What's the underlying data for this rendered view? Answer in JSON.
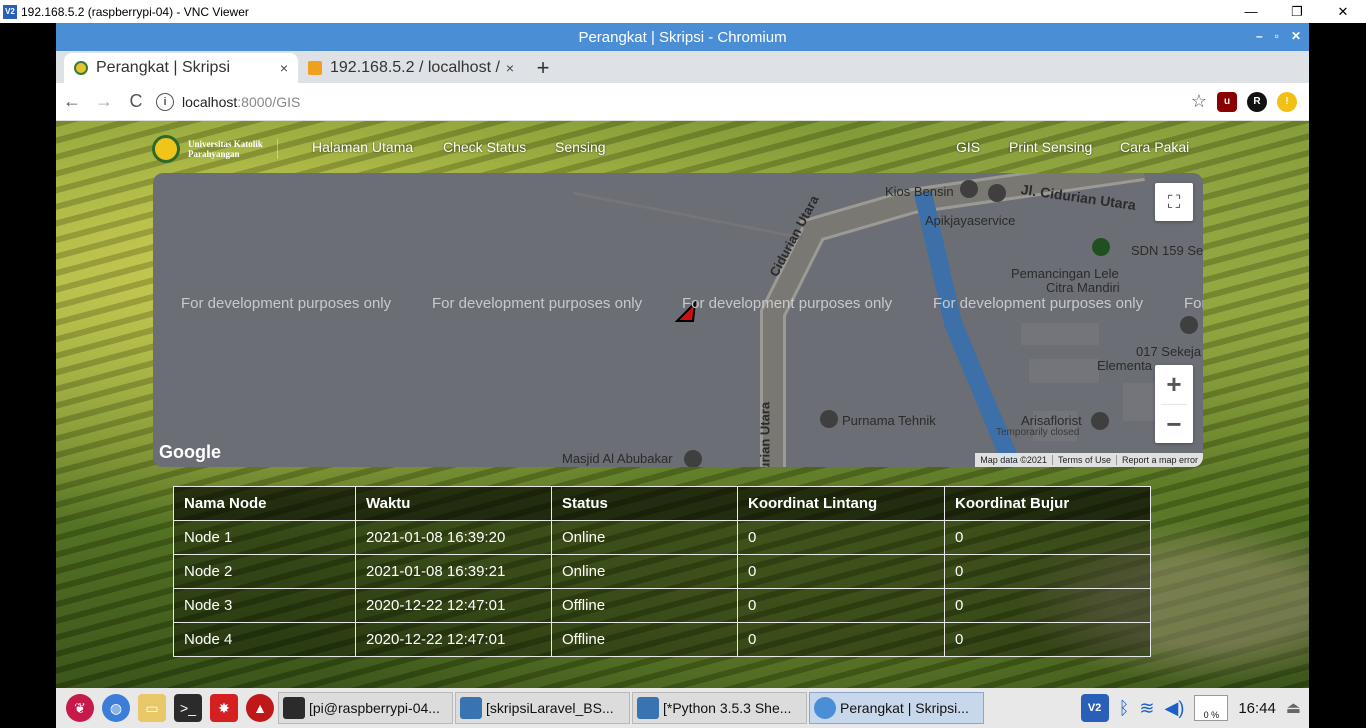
{
  "vnc": {
    "logo": "V2",
    "title": "192.168.5.2 (raspberrypi-04) - VNC Viewer",
    "minimize": "—",
    "restore": "❐",
    "close": "✕"
  },
  "chromium": {
    "window_title": "Perangkat | Skripsi - Chromium",
    "tabs": [
      {
        "label": "Perangkat | Skripsi",
        "close": "×"
      },
      {
        "label": "192.168.5.2 / localhost / ",
        "close": "×"
      }
    ],
    "new_tab": "+",
    "url_host": "localhost",
    "url_rest": ":8000/GIS"
  },
  "site": {
    "brand_line1": "Universitas Katolik",
    "brand_line2": "Parahyangan",
    "nav": {
      "home": "Halaman Utama",
      "check_status": "Check Status",
      "sensing": "Sensing",
      "gis": "GIS",
      "print_sensing": "Print Sensing",
      "cara_pakai": "Cara Pakai"
    }
  },
  "map": {
    "dev_notice": "For development purposes only",
    "dev_notice_clipped": "For",
    "labels": {
      "kios_bensin": "Kios Bensin",
      "ciduriin_utara_top": "Jl. Cidurian Utara",
      "apikjaya": "Apikjayaservice",
      "sdn": "SDN 159 Se",
      "pemancingan_1": "Pemancingan Lele",
      "pemancingan_2": "Citra Mandiri",
      "sekeja_1": "017 Sekeja",
      "sekeja_2": "Elementa",
      "road_diag": "Cidurian Utara",
      "road_vert": "Utara",
      "road_vert_2": "urian Utara",
      "purnama": "Purnama Tehnik",
      "arisa": "Arisaflorist",
      "arisa_sub": "Temporarily closed",
      "masjid": "Masjid Al Abubakar"
    },
    "google": "Google",
    "footer": [
      "Map data ©2021",
      "Terms of Use",
      "Report a map error"
    ]
  },
  "table": {
    "headers": [
      "Nama Node",
      "Waktu",
      "Status",
      "Koordinat Lintang",
      "Koordinat Bujur"
    ],
    "rows": [
      [
        "Node 1",
        "2021-01-08 16:39:20",
        "Online",
        "0",
        "0"
      ],
      [
        "Node 2",
        "2021-01-08 16:39:21",
        "Online",
        "0",
        "0"
      ],
      [
        "Node 3",
        "2020-12-22 12:47:01",
        "Offline",
        "0",
        "0"
      ],
      [
        "Node 4",
        "2020-12-22 12:47:01",
        "Offline",
        "0",
        "0"
      ]
    ]
  },
  "taskbar": {
    "tasks": [
      "[pi@raspberrypi-04...",
      "[skripsiLaravel_BS...",
      "[*Python 3.5.3 She...",
      "Perangkat | Skripsi..."
    ],
    "cpu": "0 %",
    "time": "16:44"
  }
}
